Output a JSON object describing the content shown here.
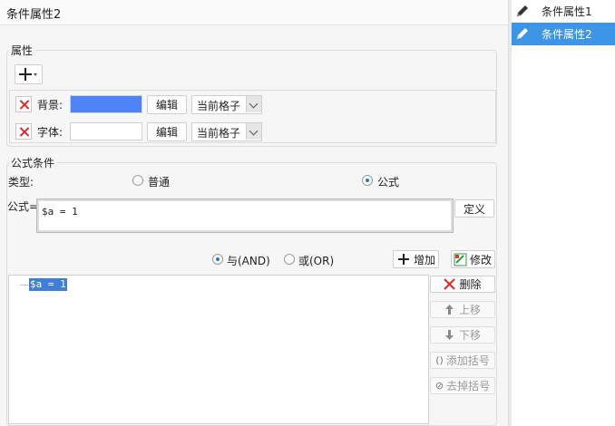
{
  "title": "条件属性2",
  "right_panel": {
    "items": [
      {
        "label": "条件属性1",
        "icon": "pencil-icon",
        "selected": false
      },
      {
        "label": "条件属性2",
        "icon": "pencil-icon",
        "selected": true
      }
    ]
  },
  "attributes": {
    "legend": "属性",
    "add_icon": "plus-icon",
    "rows": [
      {
        "label": "背景:",
        "swatch_color": "#4f84f8",
        "edit_label": "编辑",
        "scope": "当前格子"
      },
      {
        "label": "字体:",
        "swatch_color": "#ffffff",
        "edit_label": "编辑",
        "scope": "当前格子"
      }
    ]
  },
  "formula_condition": {
    "legend": "公式条件",
    "type_label": "类型:",
    "type_options": [
      {
        "label": "普通",
        "checked": false
      },
      {
        "label": "公式",
        "checked": true
      }
    ],
    "formula_label": "公式=",
    "formula_value": "$a = 1",
    "define_label": "定义",
    "logic_options": [
      {
        "label": "与(AND)",
        "checked": true
      },
      {
        "label": "或(OR)",
        "checked": false
      }
    ],
    "add_label": "增加",
    "modify_label": "修改",
    "conditions": [
      "$a = 1"
    ],
    "actions": {
      "delete": "删除",
      "move_up": "上移",
      "move_down": "下移",
      "add_paren": "添加括号",
      "remove_paren": "去掉括号"
    }
  },
  "colors": {
    "accent": "#3d95e8",
    "delete_red": "#e0272a",
    "add_green": "#2e9b3f"
  }
}
